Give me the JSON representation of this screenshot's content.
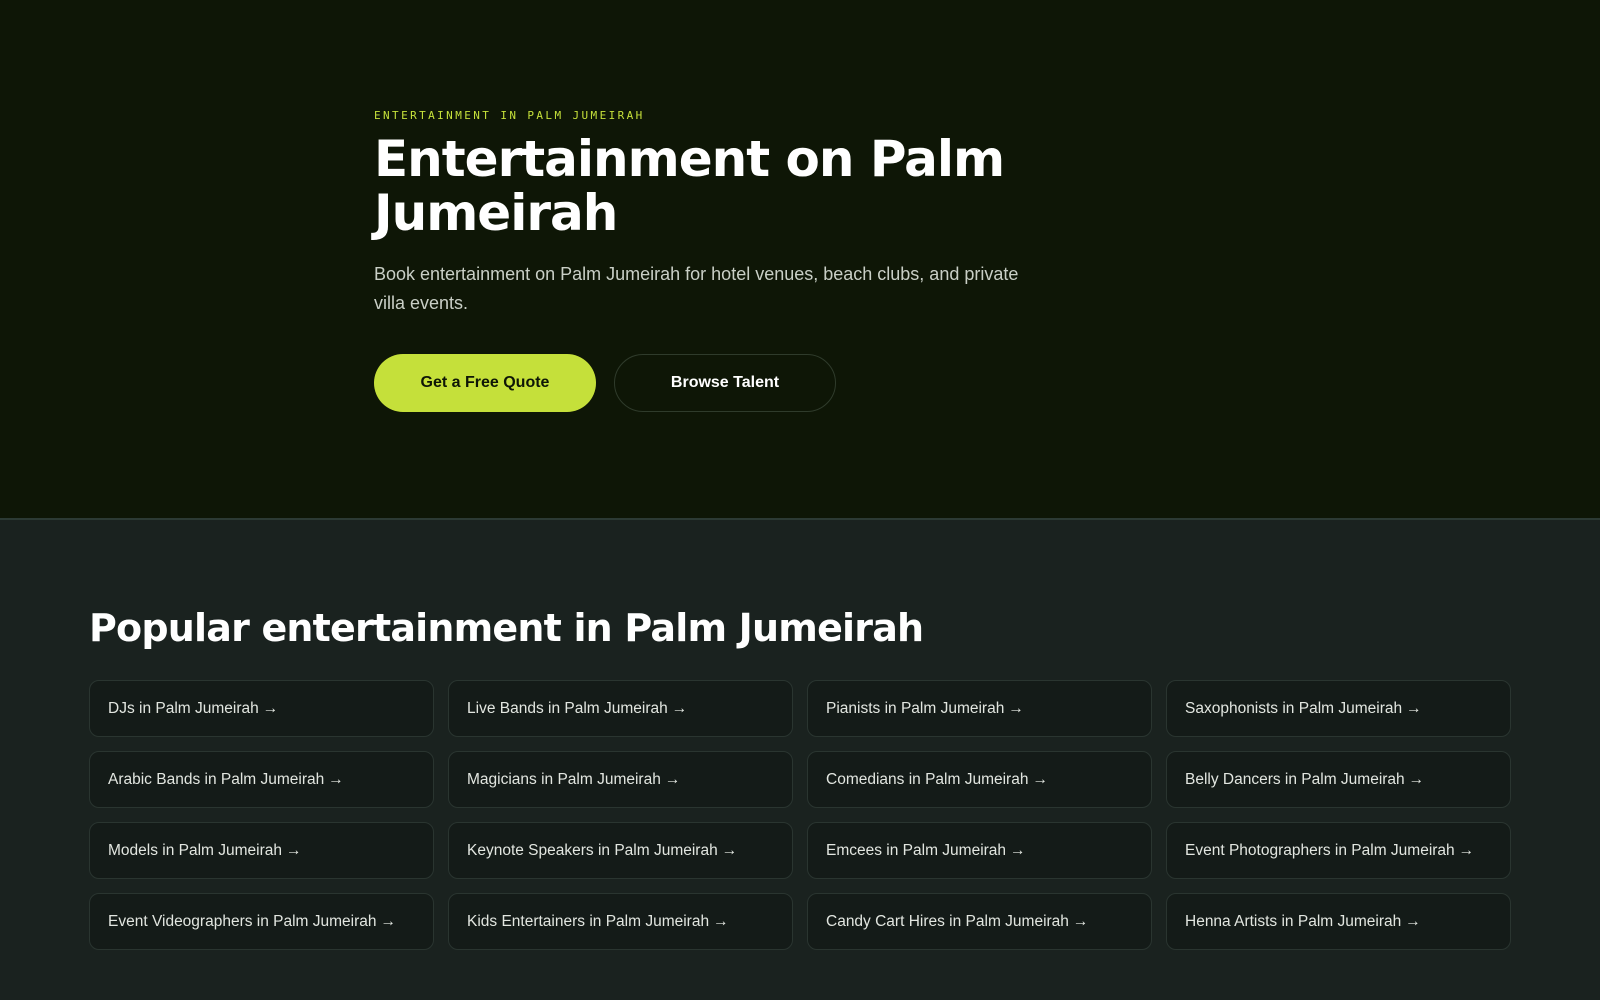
{
  "hero": {
    "eyebrow": "ENTERTAINMENT IN PALM JUMEIRAH",
    "title": "Entertainment on Palm Jumeirah",
    "subtitle": "Book entertainment on Palm Jumeirah for hotel venues, beach clubs, and private villa events.",
    "primary_button": "Get a Free Quote",
    "secondary_button": "Browse Talent"
  },
  "popular": {
    "title": "Popular entertainment in Palm Jumeirah",
    "arrow": "→",
    "items": [
      "DJs in Palm Jumeirah",
      "Live Bands in Palm Jumeirah",
      "Pianists in Palm Jumeirah",
      "Saxophonists in Palm Jumeirah",
      "Arabic Bands in Palm Jumeirah",
      "Magicians in Palm Jumeirah",
      "Comedians in Palm Jumeirah",
      "Belly Dancers in Palm Jumeirah",
      "Models in Palm Jumeirah",
      "Keynote Speakers in Palm Jumeirah",
      "Emcees in Palm Jumeirah",
      "Event Photographers in Palm Jumeirah",
      "Event Videographers in Palm Jumeirah",
      "Kids Entertainers in Palm Jumeirah",
      "Candy Cart Hires in Palm Jumeirah",
      "Henna Artists in Palm Jumeirah"
    ]
  },
  "colors": {
    "hero_bg": "#0e1606",
    "section_bg": "#1a221f",
    "accent": "#c5e03a",
    "card_bg": "#141b18"
  }
}
